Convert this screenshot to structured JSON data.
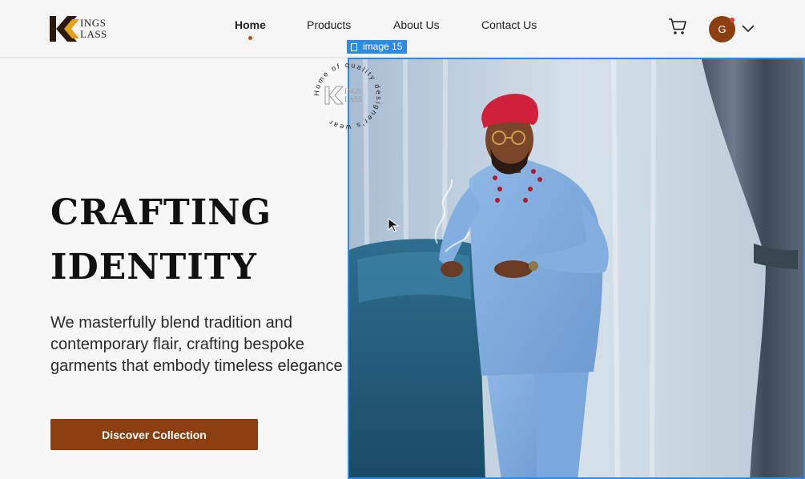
{
  "brand": {
    "logo_line1": "INGS",
    "logo_line2": "LASS",
    "mark_letter": "K"
  },
  "nav": {
    "items": [
      {
        "label": "Home",
        "active": true
      },
      {
        "label": "Products",
        "active": false
      },
      {
        "label": "About Us",
        "active": false
      },
      {
        "label": "Contact Us",
        "active": false
      }
    ]
  },
  "header": {
    "cart_icon": "cart-icon",
    "avatar_initial": "G",
    "menu_icon": "chevron-down-icon"
  },
  "hero": {
    "title_line1": "CRAFTING",
    "title_line2": "IDENTITY",
    "description": "We masterfully blend tradition and contemporary flair, crafting bespoke garments that embody timeless elegance",
    "cta_label": "Discover Collection"
  },
  "badge": {
    "ring_text": "Home of quality designer's wear",
    "inner_line1": "INGS",
    "inner_line2": "LASS"
  },
  "selection": {
    "label": "image 15"
  },
  "colors": {
    "accent": "#8b3f10",
    "selection": "#2b8be6",
    "background": "#f7f7f7"
  }
}
